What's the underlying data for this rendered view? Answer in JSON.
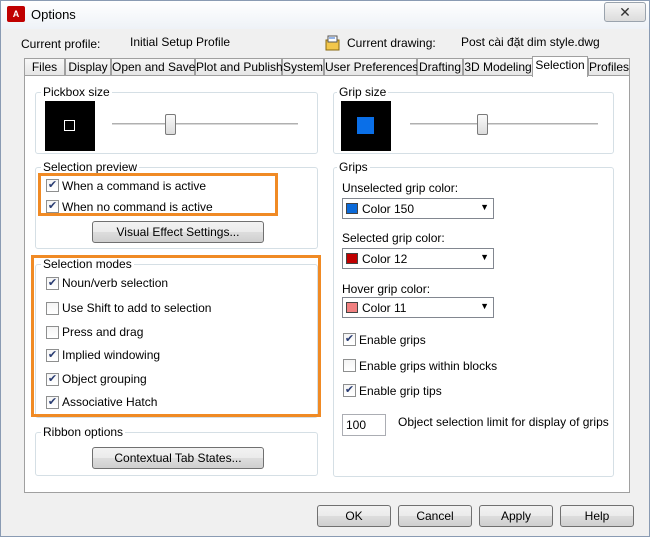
{
  "window": {
    "title": "Options",
    "app_icon_text": "A",
    "close_glyph": "✕"
  },
  "profile": {
    "current_profile_label": "Current profile:",
    "current_profile_value": "Initial Setup Profile",
    "current_drawing_label": "Current drawing:",
    "current_drawing_value": "Post cài đặt dim style.dwg"
  },
  "tabs": [
    {
      "label": "Files"
    },
    {
      "label": "Display"
    },
    {
      "label": "Open and Save"
    },
    {
      "label": "Plot and Publish"
    },
    {
      "label": "System"
    },
    {
      "label": "User Preferences"
    },
    {
      "label": "Drafting"
    },
    {
      "label": "3D Modeling"
    },
    {
      "label": "Selection",
      "active": true
    },
    {
      "label": "Profiles"
    }
  ],
  "pickbox": {
    "label": "Pickbox size",
    "slider_level": 0.3
  },
  "selection_preview": {
    "label": "Selection preview",
    "items": [
      {
        "label": "When a command is active",
        "checked": true
      },
      {
        "label": "When no command is active",
        "checked": true
      }
    ],
    "visual_effect_button": "Visual Effect Settings..."
  },
  "selection_modes": {
    "label": "Selection modes",
    "items": [
      {
        "label": "Noun/verb selection",
        "checked": true
      },
      {
        "label": "Use Shift to add to selection",
        "checked": false
      },
      {
        "label": "Press and drag",
        "checked": false
      },
      {
        "label": "Implied windowing",
        "checked": true
      },
      {
        "label": "Object grouping",
        "checked": true
      },
      {
        "label": "Associative Hatch",
        "checked": true
      }
    ]
  },
  "ribbon_options": {
    "label": "Ribbon options",
    "button": "Contextual Tab States..."
  },
  "grip_size": {
    "label": "Grip size",
    "preview_color": "#0a6fe8",
    "slider_level": 0.38
  },
  "grips": {
    "label": "Grips",
    "unselected": {
      "label": "Unselected grip color:",
      "value": "Color 150",
      "color": "#0b6ad9"
    },
    "selected": {
      "label": "Selected grip color:",
      "value": "Color 12",
      "color": "#c00000"
    },
    "hover": {
      "label": "Hover grip color:",
      "value": "Color 11",
      "color": "#f08080"
    },
    "checks": [
      {
        "label": "Enable grips",
        "checked": true
      },
      {
        "label": "Enable grips within blocks",
        "checked": false
      },
      {
        "label": "Enable grip tips",
        "checked": true
      }
    ],
    "limit_value": "100",
    "limit_label": "Object selection limit for display of grips"
  },
  "footer": {
    "ok": "OK",
    "cancel": "Cancel",
    "apply": "Apply",
    "help": "Help"
  },
  "colors": {
    "highlight": "#f08a24"
  }
}
